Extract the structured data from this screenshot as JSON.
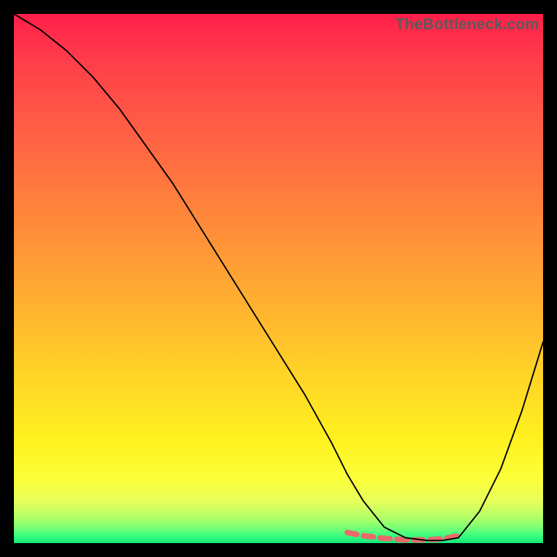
{
  "watermark": "TheBottleneck.com",
  "chart_data": {
    "type": "line",
    "title": "",
    "xlabel": "",
    "ylabel": "",
    "xlim": [
      0,
      100
    ],
    "ylim": [
      0,
      100
    ],
    "grid": false,
    "series": [
      {
        "name": "bottleneck-curve",
        "color": "#000000",
        "width": 2,
        "x": [
          0,
          5,
          10,
          15,
          20,
          25,
          30,
          35,
          40,
          45,
          50,
          55,
          60,
          63,
          66,
          70,
          74,
          78,
          81,
          84,
          88,
          92,
          96,
          100
        ],
        "values": [
          100,
          97,
          93,
          88,
          82,
          75,
          68,
          60,
          52,
          44,
          36,
          28,
          19,
          13,
          8,
          3,
          1,
          0.5,
          0.5,
          1,
          6,
          14,
          25,
          38
        ]
      },
      {
        "name": "optimal-zone",
        "color": "#e96a6a",
        "width": 8,
        "x": [
          63,
          66,
          70,
          74,
          78,
          81,
          84
        ],
        "values": [
          2.0,
          1.4,
          0.9,
          0.6,
          0.6,
          0.8,
          1.4
        ]
      }
    ]
  }
}
